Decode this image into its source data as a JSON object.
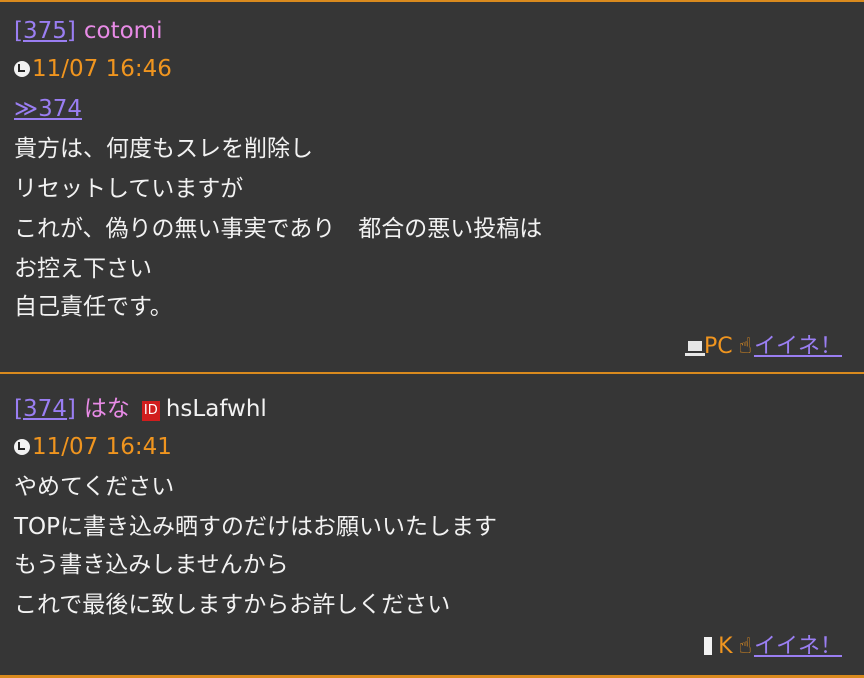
{
  "posts": [
    {
      "number": "[375]",
      "name": "cotomi",
      "date": "11/07 16:46",
      "anchor": "≫374",
      "lines": [
        "貴方は、何度もスレを削除し",
        "リセットしていますが",
        "これが、偽りの無い事実であり　都合の悪い投稿は",
        "お控え下さい",
        "自己責任です。"
      ],
      "device_icon": "pc-icon",
      "device": "PC",
      "like_icon": "thumbs-up-icon",
      "like_label": "イイネ！"
    },
    {
      "number": "[374]",
      "name": "はな",
      "badge_icon": "id-badge-icon",
      "badge": "ID",
      "trip": "hsLafwhl",
      "date": "11/07 16:41",
      "lines": [
        "やめてください",
        "TOPに書き込み晒すのだけはお願いいたします",
        "もう書き込みしませんから",
        "これで最後に致しますからお許しください"
      ],
      "device_icon": "mobile-phone-icon",
      "device": "K",
      "like_icon": "thumbs-up-icon",
      "like_label": "イイネ！"
    }
  ],
  "colors": {
    "background": "#363636",
    "separator": "#d98a1e",
    "link": "#9a7ef2",
    "name": "#e88be6",
    "date": "#f0951f",
    "text": "#f2f2f2"
  }
}
